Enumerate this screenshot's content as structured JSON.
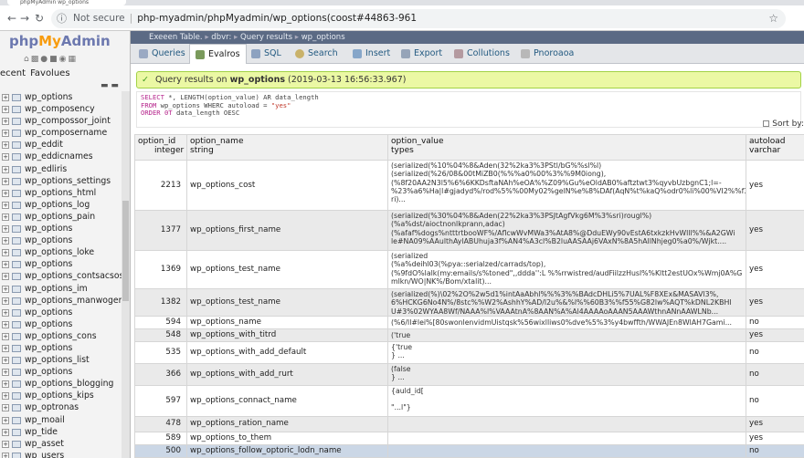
{
  "browser": {
    "tab_title": "phpMyAdmin  wp_options",
    "url_security": "Not secure",
    "url": "php-myadmin/phpMyadmin/wp_options(coost#44863-961"
  },
  "sidebar": {
    "logo_php": "php",
    "logo_my": "My",
    "logo_admin": "Admin",
    "tabs": [
      "ecent",
      "Favolues"
    ],
    "items": [
      {
        "label": "wp_options"
      },
      {
        "label": "wp_composency"
      },
      {
        "label": "wp_compossor_joint"
      },
      {
        "label": "wp_composername"
      },
      {
        "label": "wp_eddit"
      },
      {
        "label": "wp_eddicnames"
      },
      {
        "label": "wp_edliris"
      },
      {
        "label": "wp_options_settings"
      },
      {
        "label": "wp_options_html"
      },
      {
        "label": "wp_options_log"
      },
      {
        "label": "wp_options_pain"
      },
      {
        "label": "wp_options"
      },
      {
        "label": "wp_options"
      },
      {
        "label": "wp_options_loke"
      },
      {
        "label": "wp_options"
      },
      {
        "label": "wp_options_contsacsos"
      },
      {
        "label": "wp_options_im"
      },
      {
        "label": "wp_options_manwogers"
      },
      {
        "label": "wp_options"
      },
      {
        "label": "wp_options"
      },
      {
        "label": "wp_options_cons"
      },
      {
        "label": "wp_options"
      },
      {
        "label": "wp_options_list"
      },
      {
        "label": "wp_options"
      },
      {
        "label": "wp_options_blogging"
      },
      {
        "label": "wp_options_kips"
      },
      {
        "label": "wp_optronas"
      },
      {
        "label": "wp_moail"
      },
      {
        "label": "wp_tide"
      },
      {
        "label": "wp_asset"
      },
      {
        "label": "wp_users"
      }
    ]
  },
  "breadcrumb": [
    "Exeeen Table.",
    "dbvr:",
    "Query results",
    "wp_options"
  ],
  "menu": {
    "tabs": [
      "Queries",
      "Evalros",
      "SQL",
      "Search",
      "Insert",
      "Export",
      "Collutions",
      "Pnoroaoa"
    ],
    "active": "Evalros"
  },
  "message": {
    "prefix": "Query results on ",
    "table": "wp_options",
    "suffix": " (2019-03-13 16:56:33.967)"
  },
  "query": {
    "l1_kw": "SELECT",
    "l1_rest": " *, LENGTH(option_value) AR data_length",
    "l2_kw": "FROM",
    "l2_mid": " wp_options WHERC autoload = ",
    "l2_str": "\"yes\"",
    "l3_kw": "ORDER 0T",
    "l3_rest": " data_length OESC"
  },
  "sort_by_label": "Sort by:",
  "columns": [
    {
      "name": "option_id",
      "type": "integer"
    },
    {
      "name": "option_name",
      "type": "string"
    },
    {
      "name": "option_value",
      "type": "types"
    },
    {
      "name": "autoload",
      "type": "varchar"
    }
  ],
  "rows": [
    {
      "id": "2213",
      "name": "wp_options_cost",
      "value": "(serialized(%10%04%8&Aden(32%2ka3%3PStl/bG%%sl%l)\n(serialized(%26/08&00tMiZB0(%%%a0%00%3%%9M0iong),\n(%8f20AA2N3l5%6%6KKDsftaNAh%eOA%%Z09%Gu%eOldAB0%aftztwt3%qyvbUzbgnC1;l=-\n%23%a6%Ha|l#gjadyd%/rod%5%%00My02%gelN%e%8%DAf(AqN%t%kaQ%odr0%li%00%VI2%%f3\nri)...",
      "autoload": "yes"
    },
    {
      "id": "1377",
      "name": "wp_options_first_name",
      "value": "(serialized(%30%04%8&Aden(22%2ka3%3PSJtAgfVkg6M%3%sri)rougl%)\n(%a%dst/aioctnonlkprann,adac)\n(%afaf%dogs%ntttrtbooWF%/AflcwWvMWa3%AtA8%@DduEWy90vEstA6txkzkHvWlll%%&A2GWi\nle#NA09%AAulthAylABUhuja3f%AN4%A3cl%B2luAASAAj6VAxN%8A5hAllNhjeg0%a0%/Wjkt....",
      "autoload": "yes"
    },
    {
      "id": "1369",
      "name": "wp_options_test_name",
      "value": "(serialized\n(%a%deihl03(%pya::serialzed/carrads/top),\n(%9fdO%lalk(my:emails/s%toned\",,ddda'':L %%rrwistred/audFiilzzHusl%%Kltt2estUOx%Wmj0A%G\nmlkn/WO|NK%/Bom/xtalit)...",
      "autoload": "yes"
    },
    {
      "id": "1382",
      "name": "wp_options_test_name",
      "value": "(serialized(%)\\02%2O%2w5d1%intAaAbhl%%%3%%BAdcDHLi5%7UAL%F8XEx&MASAVl3%,\n6%HCKG6No4N%/8stc%%W2%AshhY%AD/l2u%&%l%%60B3%%f55%G82lw%AQT%kDNL2KBHl\nU#3%02WYAA8Wf/NAAA%l%VAAAtnA%8AAN%A%Al4AAAAoAAAN5AAAWthnANnAAWLNb...",
      "autoload": "yes"
    },
    {
      "id": "594",
      "name": "wp_options_name",
      "value": "(%6/ll#lei%[80swonlenvidmUistqsk%56wixlliws0%dve%5%3%y4bwffth/WWAJEn8WlAH7Gami...",
      "autoload": "no"
    },
    {
      "id": "548",
      "name": "wp_options_with_titrd",
      "value": "('true",
      "autoload": "yes"
    },
    {
      "id": "535",
      "name": "wp_options_with_add_default",
      "value": "{'true\n} ...",
      "autoload": "no"
    },
    {
      "id": "366",
      "name": "wp_options_with_add_rurt",
      "value": "(false\n} ...",
      "autoload": "no"
    },
    {
      "id": "597",
      "name": "wp_options_connact_name",
      "value": "{auld_id[\n\n\"...l\"}",
      "autoload": "no"
    },
    {
      "id": "478",
      "name": "wp_options_ration_name",
      "value": "",
      "autoload": "yes"
    },
    {
      "id": "589",
      "name": "wp_options_to_them",
      "value": "",
      "autoload": "yes"
    },
    {
      "id": "500",
      "name": "wp_options_follow_optoric_lodn_name",
      "value": "",
      "autoload": "no"
    }
  ],
  "colors": {
    "breadcrumb_bg": "#5b6a84",
    "success_bg": "#ebf8a4",
    "header_bg": "#f0f0f0",
    "highlight_row": "#cbd7e6"
  }
}
